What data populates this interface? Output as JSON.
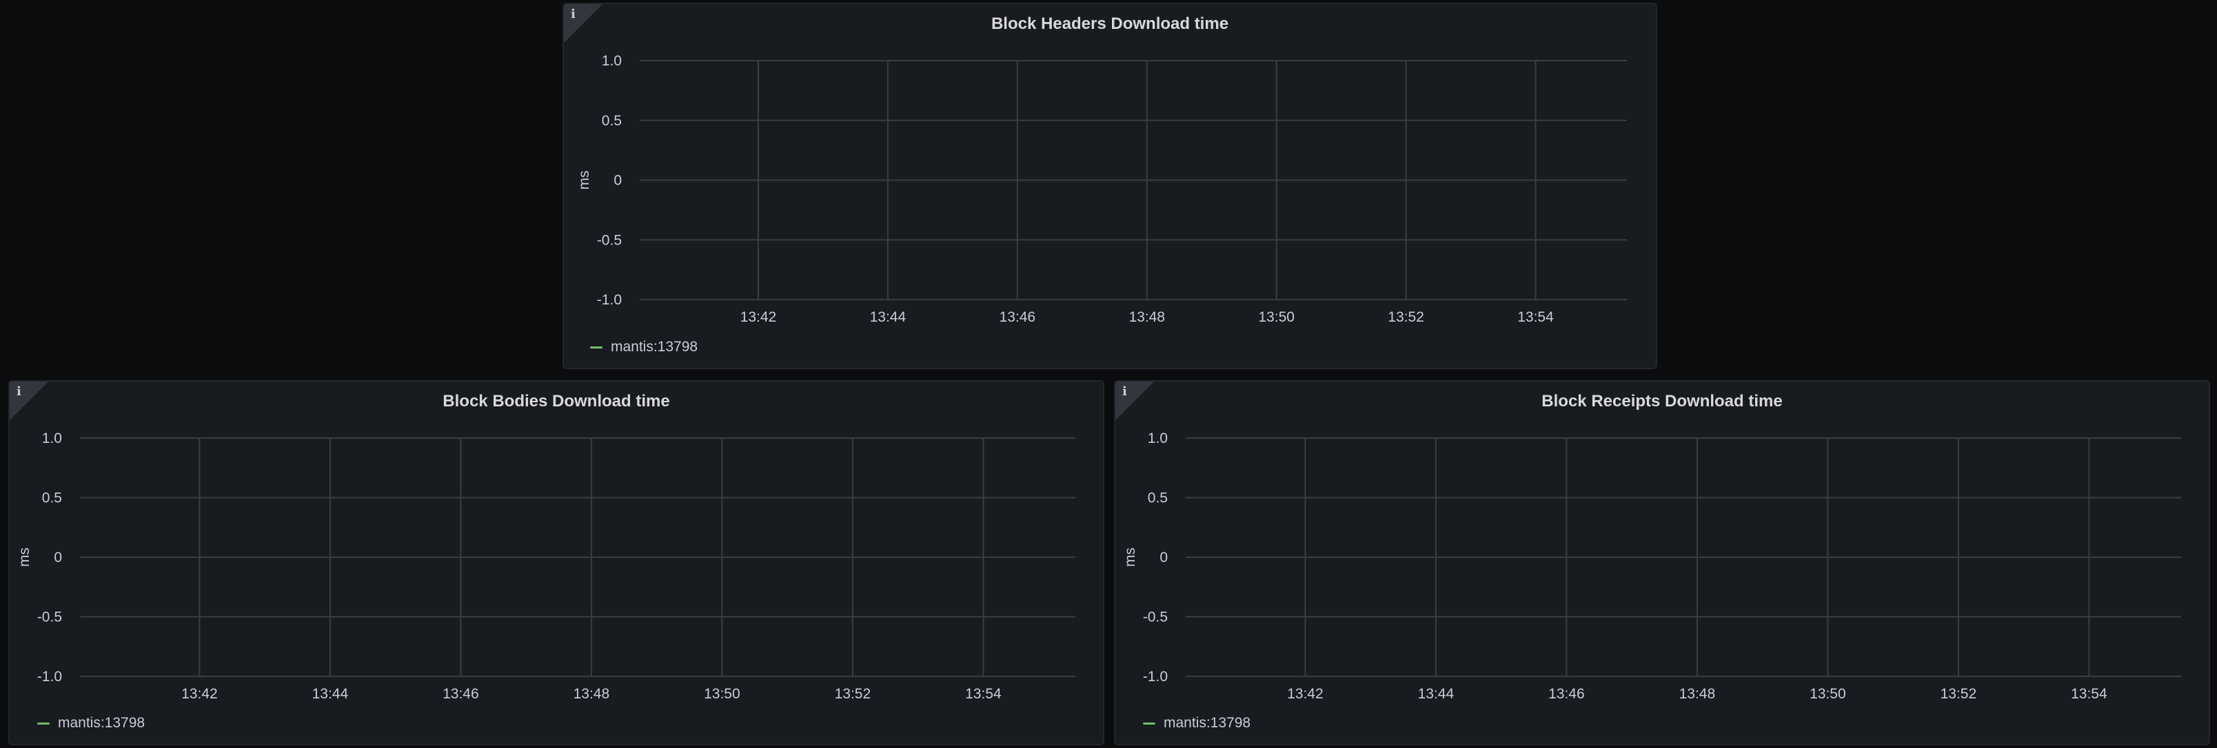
{
  "panels": [
    {
      "title": "Block Headers Download time",
      "info_icon": "info-icon",
      "legend": [
        {
          "label": "mantis:13798",
          "color": "#73bf69"
        }
      ]
    },
    {
      "title": "Block Bodies Download time",
      "info_icon": "info-icon",
      "legend": [
        {
          "label": "mantis:13798",
          "color": "#73bf69"
        }
      ]
    },
    {
      "title": "Block Receipts Download time",
      "info_icon": "info-icon",
      "legend": [
        {
          "label": "mantis:13798",
          "color": "#73bf69"
        }
      ]
    }
  ],
  "chart_data": [
    {
      "type": "line",
      "title": "Block Headers Download time",
      "xlabel": "",
      "ylabel": "ms",
      "ylim": [
        -1.0,
        1.0
      ],
      "yticks": [
        "1.0",
        "0.5",
        "0",
        "-0.5",
        "-1.0"
      ],
      "xticks": [
        "13:42",
        "13:44",
        "13:46",
        "13:48",
        "13:50",
        "13:52",
        "13:54"
      ],
      "grid": true,
      "legend_position": "bottom-left",
      "series": [
        {
          "name": "mantis:13798",
          "values": []
        }
      ]
    },
    {
      "type": "line",
      "title": "Block Bodies Download time",
      "xlabel": "",
      "ylabel": "ms",
      "ylim": [
        -1.0,
        1.0
      ],
      "yticks": [
        "1.0",
        "0.5",
        "0",
        "-0.5",
        "-1.0"
      ],
      "xticks": [
        "13:42",
        "13:44",
        "13:46",
        "13:48",
        "13:50",
        "13:52",
        "13:54"
      ],
      "grid": true,
      "legend_position": "bottom-left",
      "series": [
        {
          "name": "mantis:13798",
          "values": []
        }
      ]
    },
    {
      "type": "line",
      "title": "Block Receipts Download time",
      "xlabel": "",
      "ylabel": "ms",
      "ylim": [
        -1.0,
        1.0
      ],
      "yticks": [
        "1.0",
        "0.5",
        "0",
        "-0.5",
        "-1.0"
      ],
      "xticks": [
        "13:42",
        "13:44",
        "13:46",
        "13:48",
        "13:50",
        "13:52",
        "13:54"
      ],
      "grid": true,
      "legend_position": "bottom-left",
      "series": [
        {
          "name": "mantis:13798",
          "values": []
        }
      ]
    }
  ]
}
